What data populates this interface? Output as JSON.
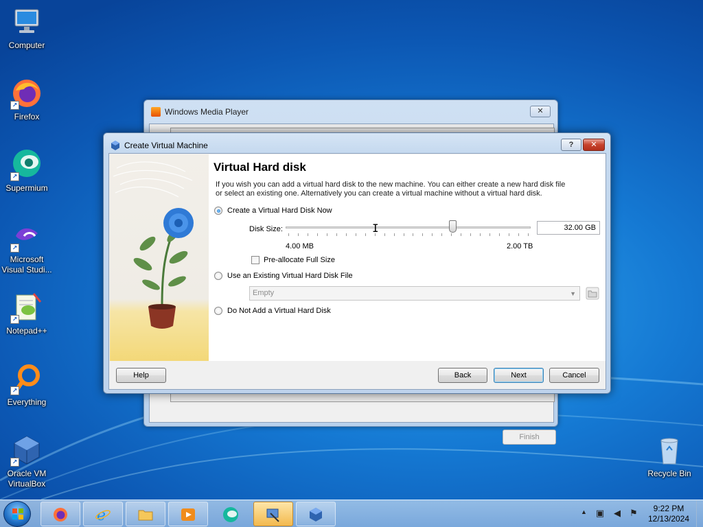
{
  "desktop": {
    "icons": [
      {
        "label_line1": "Computer",
        "label_line2": ""
      },
      {
        "label_line1": "Firefox",
        "label_line2": ""
      },
      {
        "label_line1": "Supermium",
        "label_line2": ""
      },
      {
        "label_line1": "Microsoft",
        "label_line2": "Visual Studi..."
      },
      {
        "label_line1": "Notepad++",
        "label_line2": ""
      },
      {
        "label_line1": "Everything",
        "label_line2": ""
      },
      {
        "label_line1": "Oracle VM",
        "label_line2": "VirtualBox"
      },
      {
        "label_line1": "Recycle Bin",
        "label_line2": ""
      }
    ]
  },
  "background_window": {
    "title": "Windows Media Player",
    "close_glyph": "✕",
    "finish_label": "Finish"
  },
  "dialog": {
    "title": "Create Virtual Machine",
    "help_glyph": "?",
    "close_glyph": "✕",
    "heading": "Virtual Hard disk",
    "description": "If you wish you can add a virtual hard disk to the new machine. You can either create a new hard disk file or select an existing one. Alternatively you can create a virtual machine without a virtual hard disk.",
    "options": [
      {
        "label": "Create a Virtual Hard Disk Now",
        "checked": true
      },
      {
        "label": "Use an Existing Virtual Hard Disk File",
        "checked": false
      },
      {
        "label": "Do Not Add a Virtual Hard Disk",
        "checked": false
      }
    ],
    "disk_size_label": "Disk Size:",
    "disk_size_value": "32.00 GB",
    "slider_min_label": "4.00 MB",
    "slider_max_label": "2.00 TB",
    "slider_level": 0.68,
    "preallocate_label": "Pre-allocate Full Size",
    "preallocate_checked": false,
    "existing_file_value": "Empty",
    "buttons": {
      "help": "Help",
      "back": "Back",
      "next": "Next",
      "cancel": "Cancel"
    }
  },
  "taskbar": {
    "time": "9:22 PM",
    "date": "12/13/2024",
    "tray_arrow": "▲"
  },
  "colors": {
    "dialog_accent": "#3c7fb1",
    "close_red": "#c7412c",
    "taskbar_active": "#f3b94e"
  }
}
